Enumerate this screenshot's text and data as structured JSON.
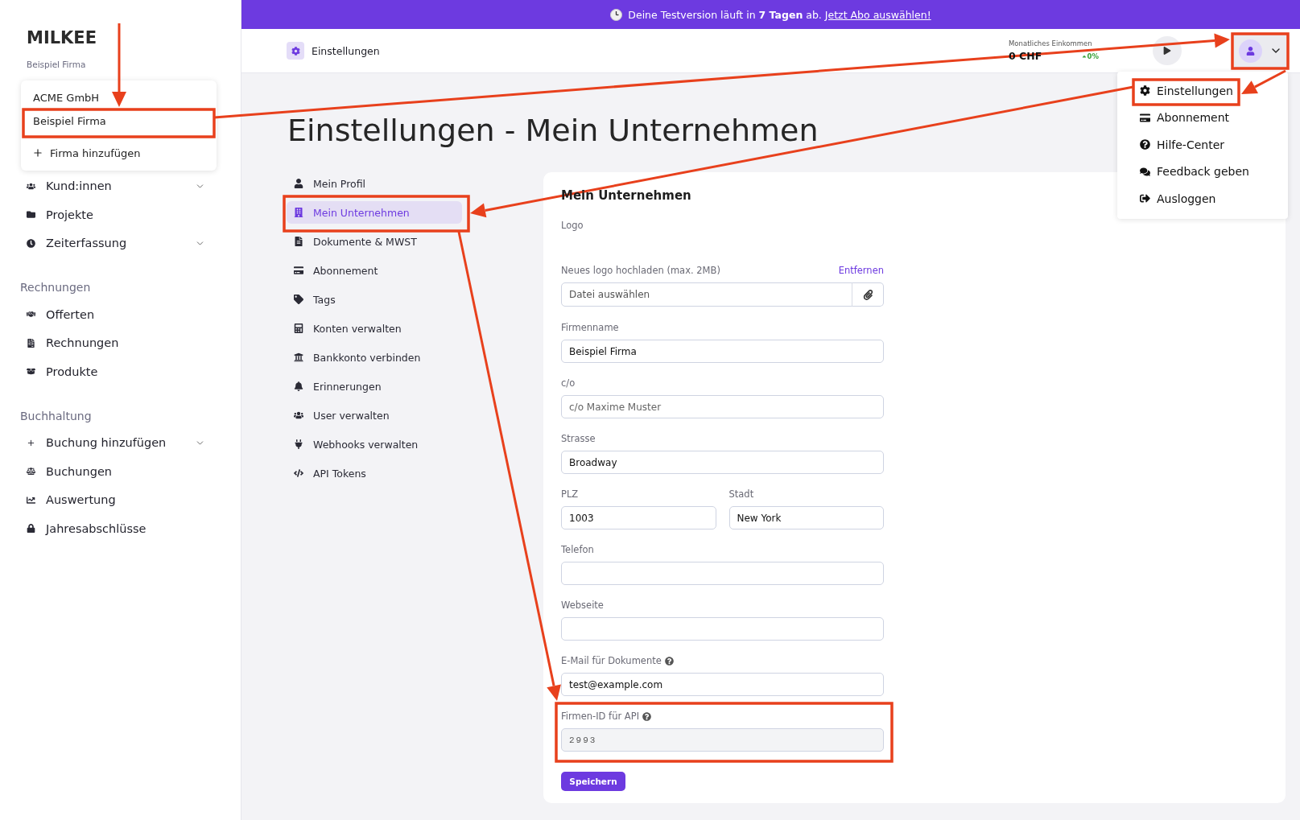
{
  "banner": {
    "text": "Deine Testversion läuft in **7 Tagen** ab.",
    "link": "Jetzt Abo auswählen!"
  },
  "sidebar": {
    "logo": "MILKEE",
    "company": "Beispiel Firma",
    "company_menu": {
      "companies": [
        {
          "name": "ACME GmbH"
        },
        {
          "name": "Beispiel Firma"
        }
      ],
      "add": "Firma hinzufügen"
    },
    "sections": [
      {
        "items": [
          {
            "label": "Kund:innen",
            "kind": "group"
          },
          {
            "label": "Projekte",
            "kind": "link"
          },
          {
            "label": "Zeiterfassung",
            "kind": "group"
          }
        ]
      },
      {
        "heading": "Rechnungen",
        "items": [
          {
            "label": "Offerten",
            "kind": "link"
          },
          {
            "label": "Rechnungen",
            "kind": "link"
          },
          {
            "label": "Produkte",
            "kind": "link"
          }
        ]
      },
      {
        "heading": "Buchhaltung",
        "items": [
          {
            "label": "Buchung hinzufügen",
            "kind": "group"
          },
          {
            "label": "Buchungen",
            "kind": "link"
          },
          {
            "label": "Auswertung",
            "kind": "link"
          },
          {
            "label": "Jahresabschlüsse",
            "kind": "link"
          }
        ]
      }
    ]
  },
  "header": {
    "title": "Einstellungen",
    "income": {
      "label": "Monatliches Einkommen",
      "value": "0 CHF",
      "change": "0%"
    }
  },
  "account_menu": {
    "items": [
      {
        "label": "Einstellungen"
      },
      {
        "label": "Abonnement"
      },
      {
        "label": "Hilfe-Center"
      },
      {
        "label": "Feedback geben"
      },
      {
        "label": "Ausloggen"
      }
    ]
  },
  "page_title": "Einstellungen - Mein Unternehmen",
  "settings_nav": [
    {
      "label": "Mein Profil",
      "selected": false
    },
    {
      "label": "Mein Unternehmen",
      "selected": true
    },
    {
      "label": "Dokumente & MWST",
      "selected": false
    },
    {
      "label": "Abonnement",
      "selected": false
    },
    {
      "label": "Tags",
      "selected": false
    },
    {
      "label": "Konten verwalten",
      "selected": false
    },
    {
      "label": "Bankkonto verbinden",
      "selected": false
    },
    {
      "label": "Erinnerungen",
      "selected": false
    },
    {
      "label": "User verwalten",
      "selected": false
    },
    {
      "label": "Webhooks verwalten",
      "selected": false
    },
    {
      "label": "API Tokens",
      "selected": false
    }
  ],
  "form": {
    "heading": "Mein Unternehmen",
    "logo_label": "Logo",
    "upload": {
      "label": "Neues logo hochladen (max. 2MB)",
      "action": "Entfernen",
      "placeholder": "Datei auswählen"
    },
    "rows": [
      {
        "fields": [
          {
            "label": "Firmenname",
            "value": "Beispiel Firma",
            "help": false,
            "disabled": false
          }
        ]
      },
      {
        "fields": [
          {
            "label": "c/o",
            "placeholder": "c/o Maxime Muster",
            "help": false,
            "disabled": false
          }
        ]
      },
      {
        "fields": [
          {
            "label": "Strasse",
            "value": "Broadway",
            "help": false,
            "disabled": false
          }
        ]
      },
      {
        "fields": [
          {
            "label": "PLZ",
            "value": "1003",
            "help": false,
            "disabled": false
          },
          {
            "label": "Stadt",
            "value": "New York",
            "help": false,
            "disabled": false
          }
        ]
      },
      {
        "fields": [
          {
            "label": "Telefon",
            "help": false,
            "disabled": false
          }
        ]
      },
      {
        "fields": [
          {
            "label": "Webseite",
            "help": false,
            "disabled": false
          }
        ]
      },
      {
        "fields": [
          {
            "label": "E-Mail für Dokumente",
            "value": "test@example.com",
            "help": true,
            "disabled": false
          }
        ]
      },
      {
        "fields": [
          {
            "label": "Firmen-ID für API",
            "value": "2993",
            "help": true,
            "disabled": true
          }
        ]
      }
    ],
    "submit": "Speichern"
  }
}
